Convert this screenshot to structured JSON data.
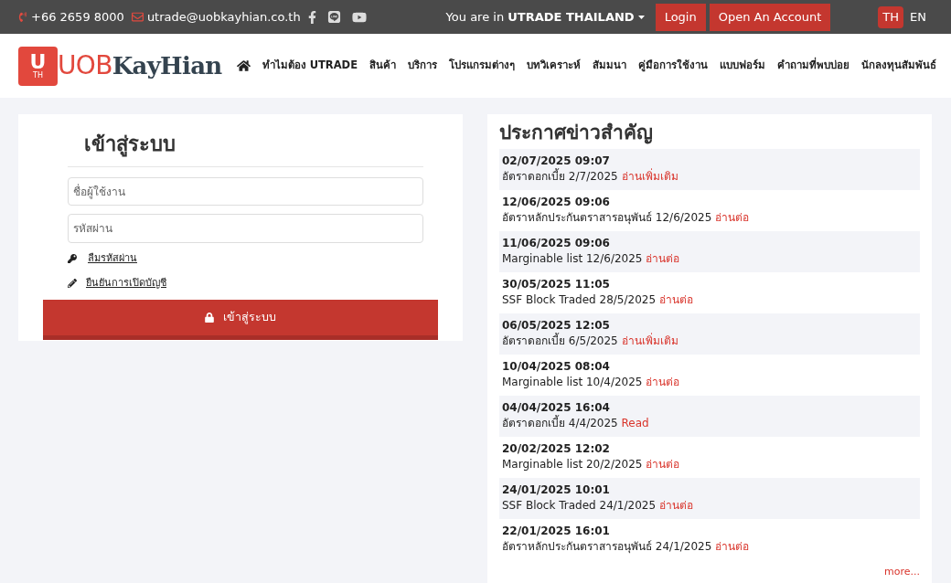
{
  "top_bar": {
    "phone": "+66 2659 8000",
    "email": "utrade@uobkayhian.co.th",
    "location_prefix": "You are in",
    "location": "UTRADE THAILAND",
    "login": "Login",
    "open_account": "Open An Account",
    "languages": [
      {
        "label": "TH",
        "selected": true
      },
      {
        "label": "EN",
        "selected": false
      }
    ]
  },
  "logo": {
    "mark": "U",
    "mark_sub": "TH",
    "part_1": "UOB",
    "part_2": "KayHian"
  },
  "nav": [
    "ทำไมต้อง UTRADE",
    "สินค้า",
    "บริการ",
    "โปรแกรมต่างๆ",
    "บทวิเคราะห์",
    "สัมมนา",
    "คู่มือการใช้งาน",
    "แบบฟอร์ม",
    "คำถามที่พบบ่อย",
    "นักลงทุนสัมพันธ์"
  ],
  "login_form": {
    "title": "เข้าสู่ระบบ",
    "username": {
      "placeholder": "ชื่อผู้ใช้งาน"
    },
    "password": {
      "placeholder": "รหัสผ่าน"
    },
    "forgot_password": "ลืมรหัสผ่าน",
    "confirm_account": "ยืนยันการเปิดบัญชี",
    "submit": "เข้าสู่ระบบ"
  },
  "news": {
    "title": "ประกาศข่าวสำคัญ",
    "items": [
      {
        "date": "02/07/2025 09:07",
        "text": "อัตราดอกเบี้ย 2/7/2025",
        "link": "อ่านเพิ่มเติม"
      },
      {
        "date": "12/06/2025 09:06",
        "text": "อัตราหลักประกันตราสารอนุพันธ์ 12/6/2025",
        "link": "อ่านต่อ"
      },
      {
        "date": "11/06/2025 09:06",
        "text": "Marginable list 12/6/2025",
        "link": "อ่านต่อ"
      },
      {
        "date": "30/05/2025 11:05",
        "text": "SSF Block Traded 28/5/2025",
        "link": "อ่านต่อ"
      },
      {
        "date": "06/05/2025 12:05",
        "text": "อัตราดอกเบี้ย 6/5/2025",
        "link": "อ่านเพิ่มเติม"
      },
      {
        "date": "10/04/2025 08:04",
        "text": "Marginable list 10/4/2025",
        "link": "อ่านต่อ"
      },
      {
        "date": "04/04/2025 16:04",
        "text": "อัตราดอกเบี้ย 4/4/2025",
        "link": "Read"
      },
      {
        "date": "20/02/2025 12:02",
        "text": "Marginable list 20/2/2025",
        "link": "อ่านต่อ"
      },
      {
        "date": "24/01/2025 10:01",
        "text": "SSF Block Traded 24/1/2025",
        "link": "อ่านต่อ"
      },
      {
        "date": "22/01/2025 16:01",
        "text": "อัตราหลักประกันตราสารอนุพันธ์ 24/1/2025",
        "link": "อ่านต่อ"
      }
    ],
    "more": "more..."
  }
}
